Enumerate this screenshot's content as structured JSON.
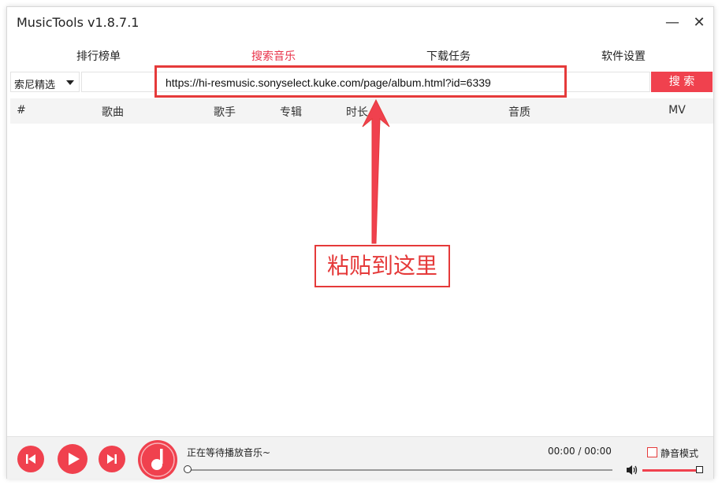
{
  "window": {
    "title": "MusicTools v1.8.7.1",
    "minimize_glyph": "—",
    "close_glyph": "✕"
  },
  "tabs": [
    {
      "label": "排行榜单",
      "active": false
    },
    {
      "label": "搜索音乐",
      "active": true
    },
    {
      "label": "下载任务",
      "active": false
    },
    {
      "label": "软件设置",
      "active": false
    }
  ],
  "search": {
    "source_value": "索尼精选",
    "input_value": "https://hi-resmusic.sonyselect.kuke.com/page/album.html?id=6339",
    "button_label": "搜 索"
  },
  "columns": [
    "#",
    "歌曲",
    "歌手",
    "专辑",
    "时长",
    "音质",
    "MV"
  ],
  "annotation": {
    "text": "粘贴到这里"
  },
  "player": {
    "status": "正在等待播放音乐~",
    "time": "00:00 / 00:00",
    "progress": 0,
    "mute_label": "静音模式",
    "mute_checked": false,
    "volume": 1.0
  },
  "colors": {
    "accent": "#f0414e",
    "annotation": "#e53a3a"
  },
  "icons": [
    "previous-icon",
    "play-icon",
    "next-icon",
    "music-note-icon",
    "volume-icon",
    "dropdown-caret-icon"
  ]
}
